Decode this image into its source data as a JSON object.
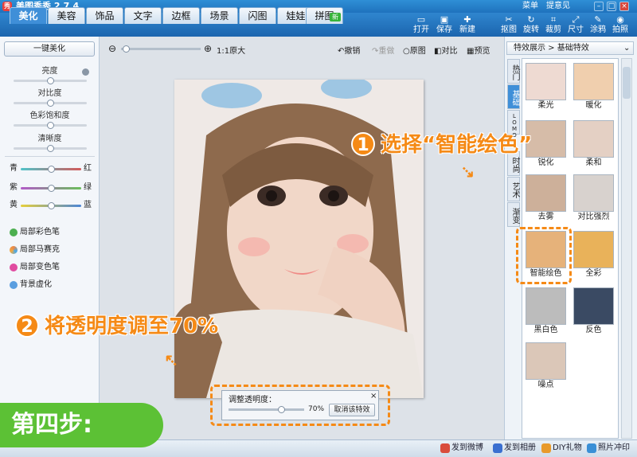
{
  "window": {
    "title": "美图秀秀 2.7.4",
    "logo_text": "秀",
    "menu": "菜单",
    "feedback": "提意见",
    "min": "–",
    "max": "□",
    "close": "×"
  },
  "tabs": [
    {
      "label": "美化"
    },
    {
      "label": "美容"
    },
    {
      "label": "饰品"
    },
    {
      "label": "文字"
    },
    {
      "label": "边框"
    },
    {
      "label": "场景"
    },
    {
      "label": "闪图"
    },
    {
      "label": "娃娃"
    },
    {
      "label": "拼图"
    }
  ],
  "new_badge": "新",
  "toolbar": [
    {
      "label": "打开",
      "icon": "▭"
    },
    {
      "label": "保存",
      "icon": "▣"
    },
    {
      "label": "新建",
      "icon": "✚"
    },
    {
      "label": "抠图",
      "icon": "✂"
    },
    {
      "label": "旋转",
      "icon": "↻"
    },
    {
      "label": "裁剪",
      "icon": "⌗"
    },
    {
      "label": "尺寸",
      "icon": "⤢"
    },
    {
      "label": "涂鸦",
      "icon": "✎"
    },
    {
      "label": "拍照",
      "icon": "◉"
    }
  ],
  "left_panel": {
    "one_click": "一键美化",
    "sliders": [
      {
        "label": "亮度",
        "value": 0.5
      },
      {
        "label": "对比度",
        "value": 0.5
      },
      {
        "label": "色彩饱和度",
        "value": 0.5
      },
      {
        "label": "清晰度",
        "value": 0.5
      }
    ],
    "color_balance": [
      {
        "left": "青",
        "right": "红",
        "value": 0.5,
        "color": "#d45a5a"
      },
      {
        "left": "紫",
        "right": "绿",
        "value": 0.5,
        "color": "#6abf5a"
      },
      {
        "left": "黄",
        "right": "蓝",
        "value": 0.5,
        "color": "#4c86d6"
      }
    ],
    "tools": [
      "局部彩色笔",
      "局部马赛克",
      "局部变色笔",
      "背景虚化"
    ]
  },
  "canvas_toolbar": {
    "zoom_label": "1:1原大",
    "undo": "撤销",
    "redo": "重做",
    "original": "原图",
    "compare": "对比",
    "preview": "预览",
    "zoom_level": 0.06
  },
  "right_panel": {
    "header": "特效展示 > 基础特效",
    "vtabs": [
      "热门",
      "基础",
      "LOMO",
      "时尚",
      "艺术",
      "渐变"
    ],
    "thumbs": [
      {
        "label": "柔光"
      },
      {
        "label": "暖化"
      },
      {
        "label": "锐化"
      },
      {
        "label": "柔和"
      },
      {
        "label": "去雾"
      },
      {
        "label": "对比强烈"
      },
      {
        "label": "智能绘色"
      },
      {
        "label": "全彩"
      },
      {
        "label": "黑白色"
      },
      {
        "label": "反色"
      },
      {
        "label": "噪点"
      }
    ]
  },
  "opacity": {
    "label": "调整透明度：",
    "value_text": "70%",
    "value": 0.7,
    "cancel": "取消该特效",
    "close": "×"
  },
  "annotations": {
    "step1_num": "1",
    "step1": "选择“智能绘色”",
    "step2_num": "2",
    "step2": "将透明度调至70%",
    "step_label": "第四步:"
  },
  "status": [
    {
      "label": "发到微博",
      "color": "#d94c3c"
    },
    {
      "label": "发到相册",
      "color": "#3a6fd0"
    },
    {
      "label": "DIY礼物",
      "color": "#e89a2c"
    },
    {
      "label": "照片冲印",
      "color": "#3a8fd6"
    }
  ]
}
